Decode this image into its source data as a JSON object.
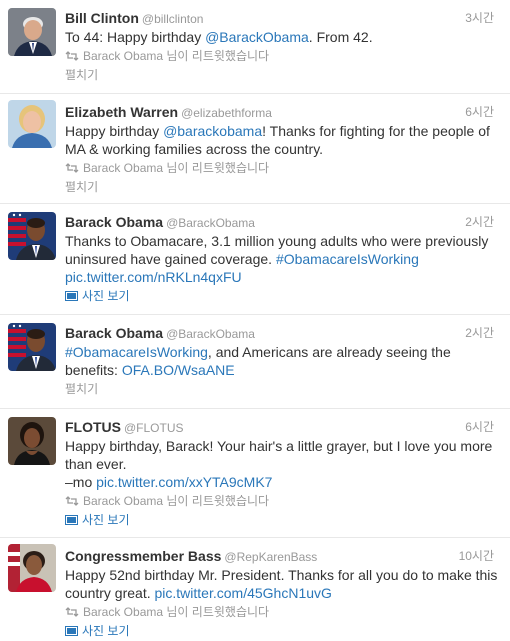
{
  "colors": {
    "link": "#2a77b9",
    "meta": "#999999",
    "text": "#333333",
    "divider": "#e8e8e8"
  },
  "tweets": [
    {
      "name": "Bill Clinton",
      "handle": "@billclinton",
      "time": "3시간",
      "text_1": "To 44: Happy birthday ",
      "link_1": "@BarackObama",
      "text_2": ". From 42.",
      "retweet_by": "Barack Obama 님이 리트윗했습니다",
      "action": "펼치기",
      "avatar_icon": "bill-clinton-portrait"
    },
    {
      "name": "Elizabeth Warren",
      "handle": "@elizabethforma",
      "time": "6시간",
      "text_1": "Happy birthday ",
      "link_1": "@barackobama",
      "text_2": "! Thanks for fighting for the people of MA & working families across the country.",
      "retweet_by": "Barack Obama 님이 리트윗했습니다",
      "action": "펼치기",
      "avatar_icon": "elizabeth-warren-portrait"
    },
    {
      "name": "Barack Obama",
      "handle": "@BarackObama",
      "time": "2시간",
      "text_1": "Thanks to Obamacare, 3.1 million young adults who were previously uninsured have gained coverage. ",
      "link_1": "#ObamacareIsWorking",
      "text_2": " ",
      "link_2": "pic.twitter.com/nRKLn4qxFU",
      "action": "사진 보기",
      "avatar_icon": "barack-obama-portrait"
    },
    {
      "name": "Barack Obama",
      "handle": "@BarackObama",
      "time": "2시간",
      "link_1": "#ObamacareIsWorking",
      "text_1": ", and Americans are already seeing the benefits: ",
      "link_2": "OFA.BO/WsaANE",
      "action": "펼치기",
      "avatar_icon": "barack-obama-portrait"
    },
    {
      "name": "FLOTUS",
      "handle": "@FLOTUS",
      "time": "6시간",
      "text_1": "Happy birthday, Barack! Your hair's a little grayer, but I love you more than ever.",
      "text_2": "–mo ",
      "link_1": "pic.twitter.com/xxYTA9cMK7",
      "retweet_by": "Barack Obama 님이 리트윗했습니다",
      "action": "사진 보기",
      "avatar_icon": "michelle-obama-portrait"
    },
    {
      "name": "Congressmember Bass",
      "handle": "@RepKarenBass",
      "time": "10시간",
      "text_1": "Happy 52nd birthday Mr. President. Thanks for all you do to make this country great. ",
      "link_1": "pic.twitter.com/45GhcN1uvG",
      "retweet_by": "Barack Obama 님이 리트윗했습니다",
      "action": "사진 보기",
      "avatar_icon": "karen-bass-portrait"
    }
  ]
}
